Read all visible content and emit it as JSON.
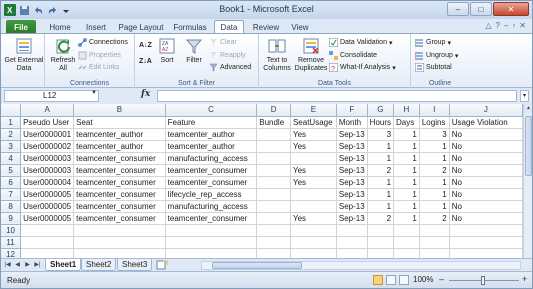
{
  "window": {
    "title": "Book1 - Microsoft Excel",
    "controls": {
      "minimize": "–",
      "maximize": "□",
      "close": "✕"
    }
  },
  "ribbon_tabs": [
    "File",
    "Home",
    "Insert",
    "Page Layout",
    "Formulas",
    "Data",
    "Review",
    "View"
  ],
  "active_tab": "Data",
  "ribbon": {
    "get_external_data": "Get External Data",
    "refresh_all": "Refresh All",
    "connections": "Connections",
    "properties": "Properties",
    "edit_links": "Edit Links",
    "connections_group": "Connections",
    "sort": "Sort",
    "filter": "Filter",
    "clear": "Clear",
    "reapply": "Reapply",
    "advanced": "Advanced",
    "sort_filter_group": "Sort & Filter",
    "text_to_columns": "Text to Columns",
    "remove_duplicates": "Remove Duplicates",
    "data_validation": "Data Validation",
    "consolidate": "Consolidate",
    "what_if": "What-If Analysis",
    "data_tools_group": "Data Tools",
    "group": "Group",
    "ungroup": "Ungroup",
    "subtotal": "Subtotal",
    "outline_group": "Outline"
  },
  "formula_bar": {
    "name_box": "L12",
    "fx": "fx",
    "formula": ""
  },
  "columns": [
    "A",
    "B",
    "C",
    "D",
    "E",
    "F",
    "G",
    "H",
    "I",
    "J"
  ],
  "rows": [
    [
      "Pseudo User",
      "Seat",
      "Feature",
      "Bundle",
      "SeatUsage",
      "Month",
      "Hours",
      "Days",
      "Logins",
      "Usage Violation"
    ],
    [
      "User0000001",
      "teamcenter_author",
      "teamcenter_author",
      "",
      "Yes",
      "Sep-13",
      "3",
      "1",
      "3",
      "No"
    ],
    [
      "User0000002",
      "teamcenter_author",
      "teamcenter_author",
      "",
      "Yes",
      "Sep-13",
      "1",
      "1",
      "1",
      "No"
    ],
    [
      "User0000003",
      "teamcenter_consumer",
      "manufacturing_access",
      "",
      "",
      "Sep-13",
      "1",
      "1",
      "1",
      "No"
    ],
    [
      "User0000003",
      "teamcenter_consumer",
      "teamcenter_consumer",
      "",
      "Yes",
      "Sep-13",
      "2",
      "1",
      "2",
      "No"
    ],
    [
      "User0000004",
      "teamcenter_consumer",
      "teamcenter_consumer",
      "",
      "Yes",
      "Sep-13",
      "1",
      "1",
      "1",
      "No"
    ],
    [
      "User0000005",
      "teamcenter_consumer",
      "lifecycle_rep_access",
      "",
      "",
      "Sep-13",
      "1",
      "1",
      "1",
      "No"
    ],
    [
      "User0000005",
      "teamcenter_consumer",
      "manufacturing_access",
      "",
      "",
      "Sep-13",
      "1",
      "1",
      "1",
      "No"
    ],
    [
      "User0000005",
      "teamcenter_consumer",
      "teamcenter_consumer",
      "",
      "Yes",
      "Sep-13",
      "2",
      "1",
      "2",
      "No"
    ],
    [
      "",
      "",
      "",
      "",
      "",
      "",
      "",
      "",
      "",
      ""
    ],
    [
      "",
      "",
      "",
      "",
      "",
      "",
      "",
      "",
      "",
      ""
    ],
    [
      "",
      "",
      "",
      "",
      "",
      "",
      "",
      "",
      "",
      ""
    ]
  ],
  "row_numbers": [
    "1",
    "2",
    "3",
    "4",
    "5",
    "6",
    "7",
    "8",
    "9",
    "10",
    "11",
    "12"
  ],
  "sheets": [
    "Sheet1",
    "Sheet2",
    "Sheet3"
  ],
  "active_sheet": "Sheet1",
  "status": {
    "mode": "Ready",
    "zoom": "100%",
    "minus": "–",
    "plus": "+"
  },
  "colors": {
    "file_tab": "#2a7a2a",
    "header_bg": "#e4ebf4",
    "grid_line": "#d4d4d4",
    "accent": "#1e395b"
  }
}
